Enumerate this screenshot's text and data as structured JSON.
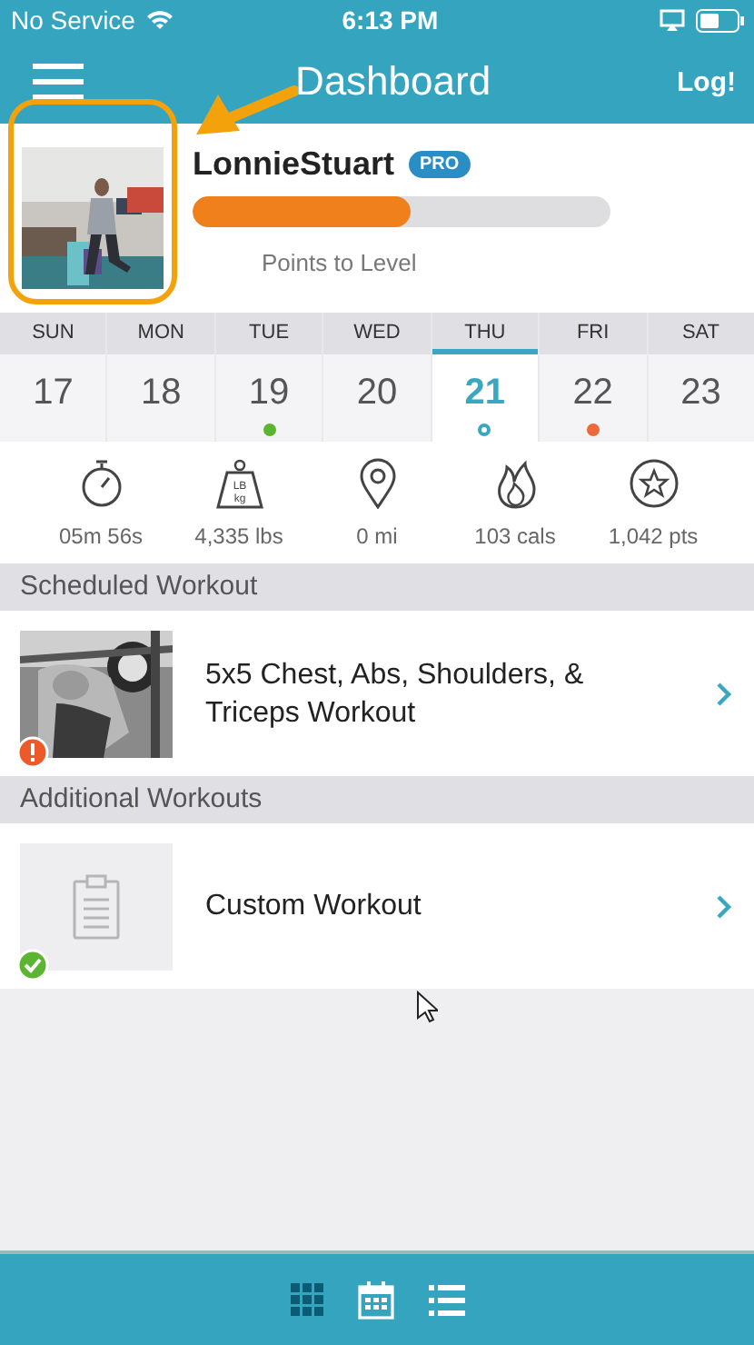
{
  "status_bar": {
    "carrier": "No Service",
    "time": "6:13 PM"
  },
  "header": {
    "title": "Dashboard",
    "action": "Log!"
  },
  "profile": {
    "name": "LonnieStuart",
    "badge": "PRO",
    "level": 0.52,
    "caption": "Points to Level"
  },
  "days": [
    {
      "label": "SUN",
      "date": "17",
      "selected": false
    },
    {
      "label": "MON",
      "date": "18",
      "selected": false
    },
    {
      "label": "TUE",
      "date": "19",
      "selected": false,
      "dot": {
        "color": "#5cb531",
        "hollow": false
      }
    },
    {
      "label": "WED",
      "date": "20",
      "selected": false
    },
    {
      "label": "THU",
      "date": "21",
      "selected": true,
      "dot": {
        "color": "#3aa7c0",
        "hollow": true
      }
    },
    {
      "label": "FRI",
      "date": "22",
      "selected": false,
      "dot": {
        "color": "#ec6a3a",
        "hollow": false
      }
    },
    {
      "label": "SAT",
      "date": "23",
      "selected": false
    }
  ],
  "stats": [
    {
      "kind": "timer",
      "value": "05m 56s"
    },
    {
      "kind": "weight",
      "value": "4,335 lbs",
      "icon_text": [
        "LB",
        "kg"
      ]
    },
    {
      "kind": "distance",
      "value": "0 mi"
    },
    {
      "kind": "calories",
      "value": "103 cals"
    },
    {
      "kind": "points",
      "value": "1,042 pts"
    }
  ],
  "sections": [
    {
      "title": "Scheduled Workout",
      "workouts": [
        {
          "title": "5x5 Chest, Abs, Shoulders, & Triceps Workout",
          "badge": {
            "kind": "alert"
          }
        }
      ]
    },
    {
      "title": "Additional Workouts",
      "workouts": [
        {
          "title": "Custom Workout",
          "thumb": {
            "kind": "placeholder"
          },
          "badge": {
            "kind": "done"
          }
        }
      ]
    }
  ],
  "tab_bar": [
    {
      "kind": "grid",
      "selected": true
    },
    {
      "kind": "calendar",
      "selected": false
    },
    {
      "kind": "list",
      "selected": false
    }
  ]
}
